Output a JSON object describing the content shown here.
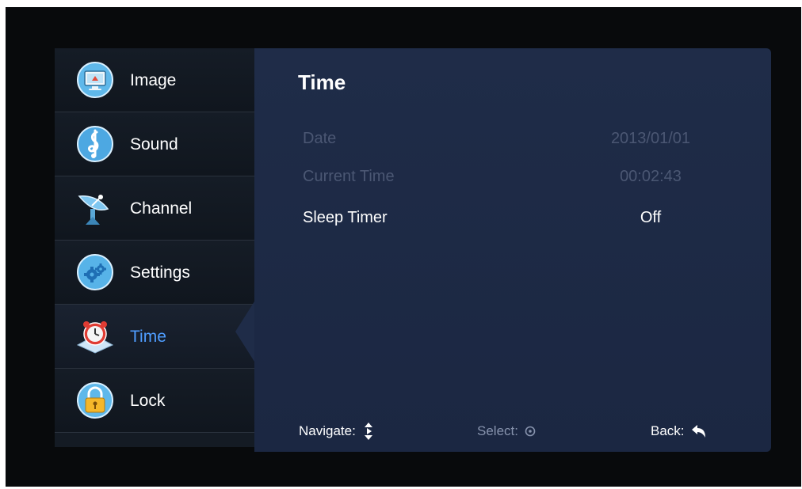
{
  "sidebar": {
    "items": [
      {
        "label": "Image",
        "icon": "monitor-icon"
      },
      {
        "label": "Sound",
        "icon": "music-note-icon"
      },
      {
        "label": "Channel",
        "icon": "satellite-dish-icon"
      },
      {
        "label": "Settings",
        "icon": "gear-icon"
      },
      {
        "label": "Time",
        "icon": "alarm-clock-icon",
        "active": true
      },
      {
        "label": "Lock",
        "icon": "padlock-icon"
      }
    ]
  },
  "panel": {
    "title": "Time",
    "rows": [
      {
        "label": "Date",
        "value": "2013/01/01",
        "enabled": false
      },
      {
        "label": "Current Time",
        "value": "00:02:43",
        "enabled": false
      },
      {
        "label": "Sleep Timer",
        "value": "Off",
        "enabled": true
      }
    ]
  },
  "footer": {
    "navigate": "Navigate:",
    "select": "Select:",
    "back": "Back:"
  },
  "colors": {
    "accent": "#4f9dff",
    "panel": "#1f2c48",
    "sidebar": "#141b24",
    "disabled_text": "#4b5773"
  }
}
